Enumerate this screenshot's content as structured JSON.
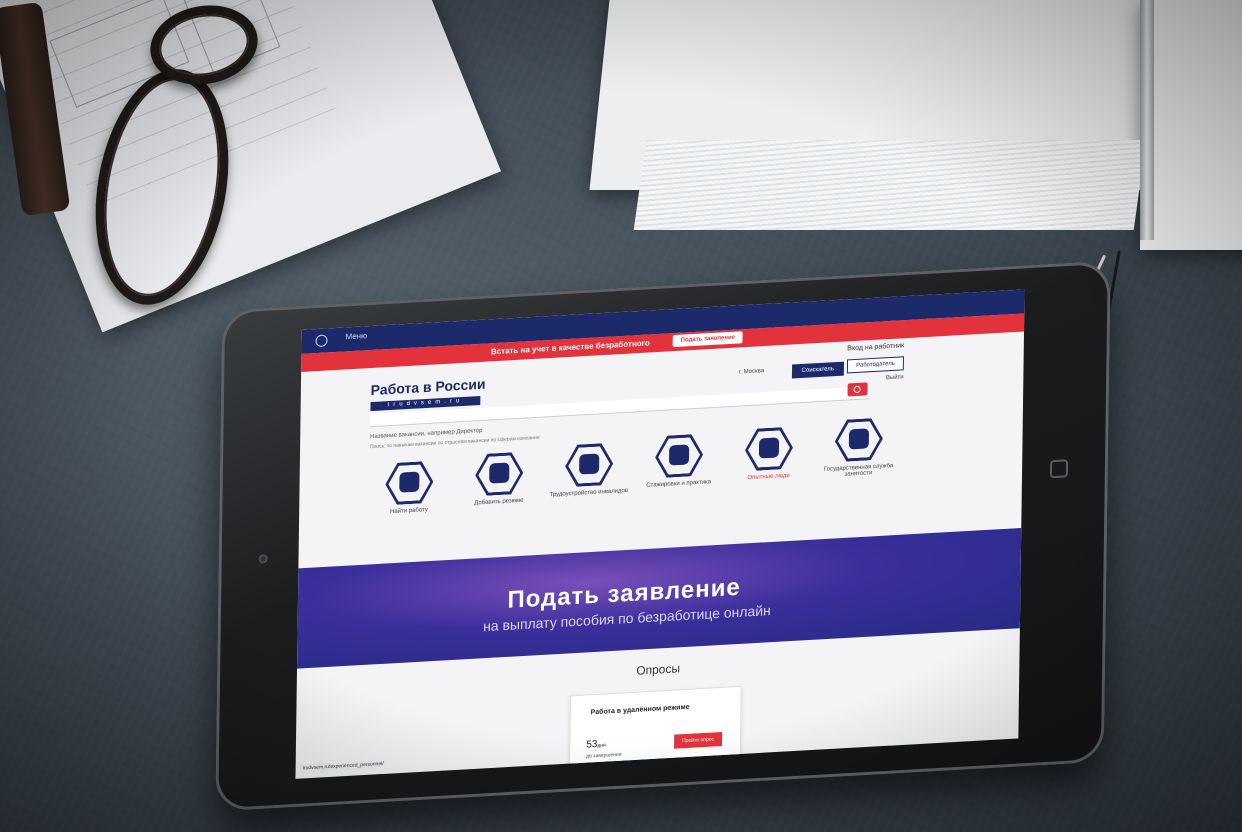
{
  "site": {
    "menu_label": "Меню",
    "red_banner_text": "Встать на учет в качестве безработного",
    "red_banner_button": "Подать заявление",
    "logo_title": "Работа в России",
    "logo_domain": "trudvsem.ru",
    "login_link": "Вход на работник",
    "tab_applicant": "Соискатель",
    "tab_employer": "Работодатель",
    "city": "г. Москва",
    "exit_label": "Выйти",
    "search_filters_text": "Название вакансии, например   Директор",
    "search_links_text": "Поиск:   по навыкам вакансии   по отраслям вакансии   по сферам компании"
  },
  "services": [
    {
      "label": "Найти работу",
      "icon": "briefcase-icon",
      "red": false
    },
    {
      "label": "Добавить резюме",
      "icon": "document-icon",
      "red": false
    },
    {
      "label": "Трудоустройство инвалидов",
      "icon": "wheelchair-icon",
      "red": false
    },
    {
      "label": "Стажировки и практика",
      "icon": "graduation-cap-icon",
      "red": false
    },
    {
      "label": "Опытные люди",
      "icon": "person-icon",
      "red": true
    },
    {
      "label": "Государственная служба занятости",
      "icon": "hammers-icon",
      "red": false
    }
  ],
  "hero": {
    "title": "Подать заявление",
    "subtitle": "на выплату пособия по безработице онлайн"
  },
  "polls": {
    "heading": "Опросы",
    "card_title": "Работа в удалённом режиме",
    "days_value": "53",
    "days_unit": "дня",
    "sub_text": "до завершения",
    "button_label": "Пройти опрос"
  },
  "status_url": "trudvsem.ru/experienced_personnel/",
  "colors": {
    "brand_navy": "#1c2a6b",
    "brand_red": "#e2323b",
    "banner_purple": "#3b2f9c"
  }
}
